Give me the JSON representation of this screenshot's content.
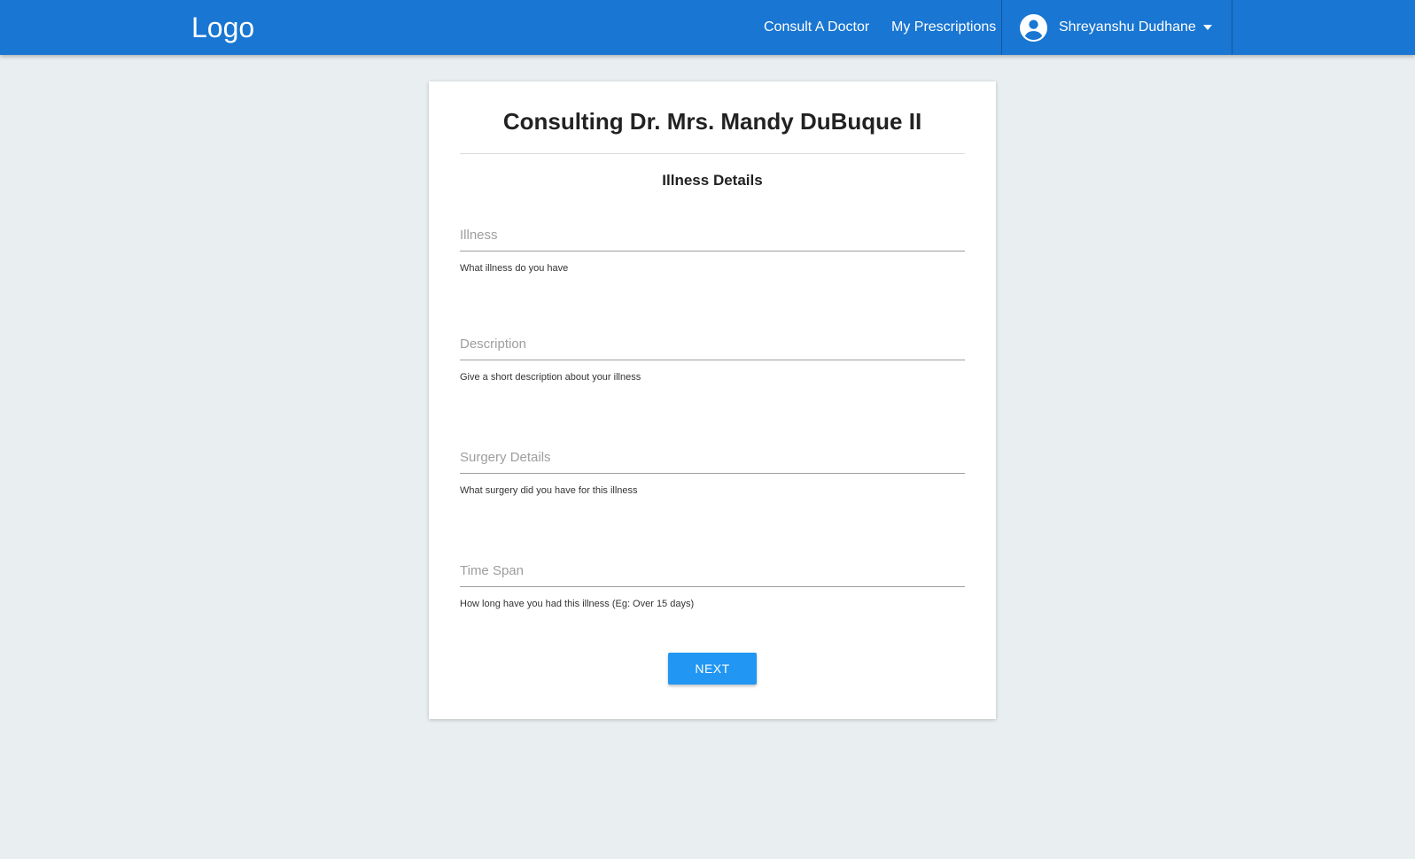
{
  "navbar": {
    "logo": "Logo",
    "links": {
      "consult": "Consult A Doctor",
      "prescriptions": "My Prescriptions"
    },
    "user": {
      "name": "Shreyanshu Dudhane",
      "avatar_icon": "account-circle-icon",
      "dropdown_icon": "caret-down-icon"
    },
    "color": "#1976d2"
  },
  "card": {
    "title": "Consulting Dr. Mrs. Mandy DuBuque II",
    "section_title": "Illness Details",
    "fields": [
      {
        "placeholder": "Illness",
        "value": "",
        "helper": "What illness do you have"
      },
      {
        "placeholder": "Description",
        "value": "",
        "helper": "Give a short description about your illness"
      },
      {
        "placeholder": "Surgery Details",
        "value": "",
        "helper": "What surgery did you have for this illness"
      },
      {
        "placeholder": "Time Span",
        "value": "",
        "helper": "How long have you had this illness (Eg: Over 15 days)"
      }
    ],
    "next_label": "NEXT",
    "button_color": "#2196f3"
  }
}
